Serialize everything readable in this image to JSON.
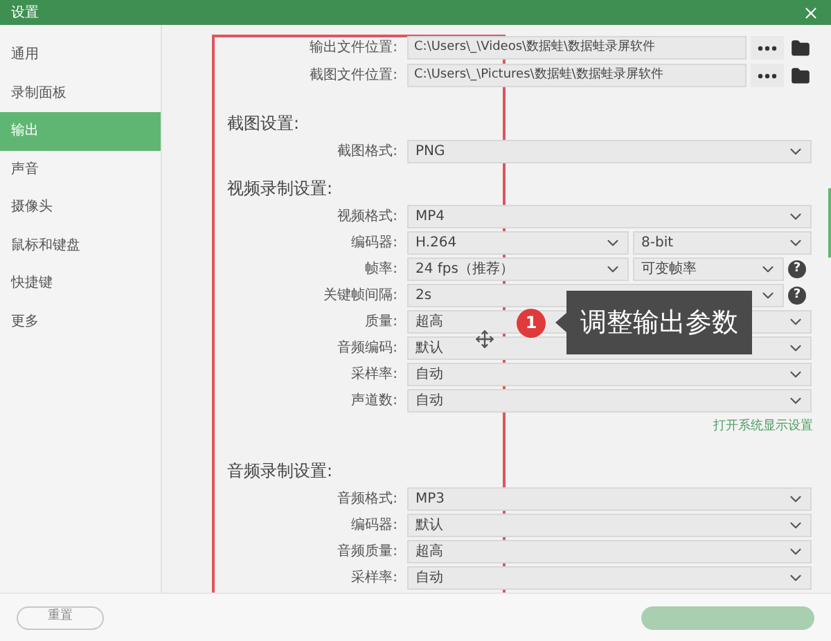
{
  "window": {
    "title": "设置"
  },
  "sidebar": {
    "items": [
      {
        "label": "通用",
        "selected": false
      },
      {
        "label": "录制面板",
        "selected": false
      },
      {
        "label": "输出",
        "selected": true
      },
      {
        "label": "声音",
        "selected": false
      },
      {
        "label": "摄像头",
        "selected": false
      },
      {
        "label": "鼠标和键盘",
        "selected": false
      },
      {
        "label": "快捷键",
        "selected": false
      },
      {
        "label": "更多",
        "selected": false
      }
    ]
  },
  "paths": [
    {
      "label": "输出文件位置:",
      "value": "C:\\Users\\_\\Videos\\数据蛙\\数据蛙录屏软件"
    },
    {
      "label": "截图文件位置:",
      "value": "C:\\Users\\_\\Pictures\\数据蛙\\数据蛙录屏软件"
    }
  ],
  "sections": [
    {
      "title": "截图设置:",
      "rows": [
        {
          "kind": "single",
          "label": "截图格式:",
          "value": "PNG"
        }
      ]
    },
    {
      "title": "视频录制设置:",
      "rows": [
        {
          "kind": "single",
          "label": "视频格式:",
          "value": "MP4"
        },
        {
          "kind": "split",
          "label": "编码器:",
          "value": "H.264",
          "value2": "8-bit"
        },
        {
          "kind": "split",
          "label": "帧率:",
          "value": "24 fps（推荐）",
          "value2": "可变帧率",
          "help": "?"
        },
        {
          "kind": "single",
          "label": "关键帧间隔:",
          "value": "2s",
          "help": "?"
        },
        {
          "kind": "single",
          "label": "质量:",
          "value": "超高"
        },
        {
          "kind": "single",
          "label": "音频编码:",
          "value": "默认"
        },
        {
          "kind": "single",
          "label": "采样率:",
          "value": "自动"
        },
        {
          "kind": "single",
          "label": "声道数:",
          "value": "自动"
        }
      ],
      "link": "打开系统显示设置"
    },
    {
      "title": "音频录制设置:",
      "rows": [
        {
          "kind": "single",
          "label": "音频格式:",
          "value": "MP3"
        },
        {
          "kind": "single",
          "label": "编码器:",
          "value": "默认"
        },
        {
          "kind": "single",
          "label": "音频质量:",
          "value": "超高"
        },
        {
          "kind": "single",
          "label": "采样率:",
          "value": "自动"
        }
      ]
    }
  ],
  "callout": {
    "number": "1",
    "text": "调整输出参数"
  },
  "footer": {
    "reset": "重置"
  }
}
